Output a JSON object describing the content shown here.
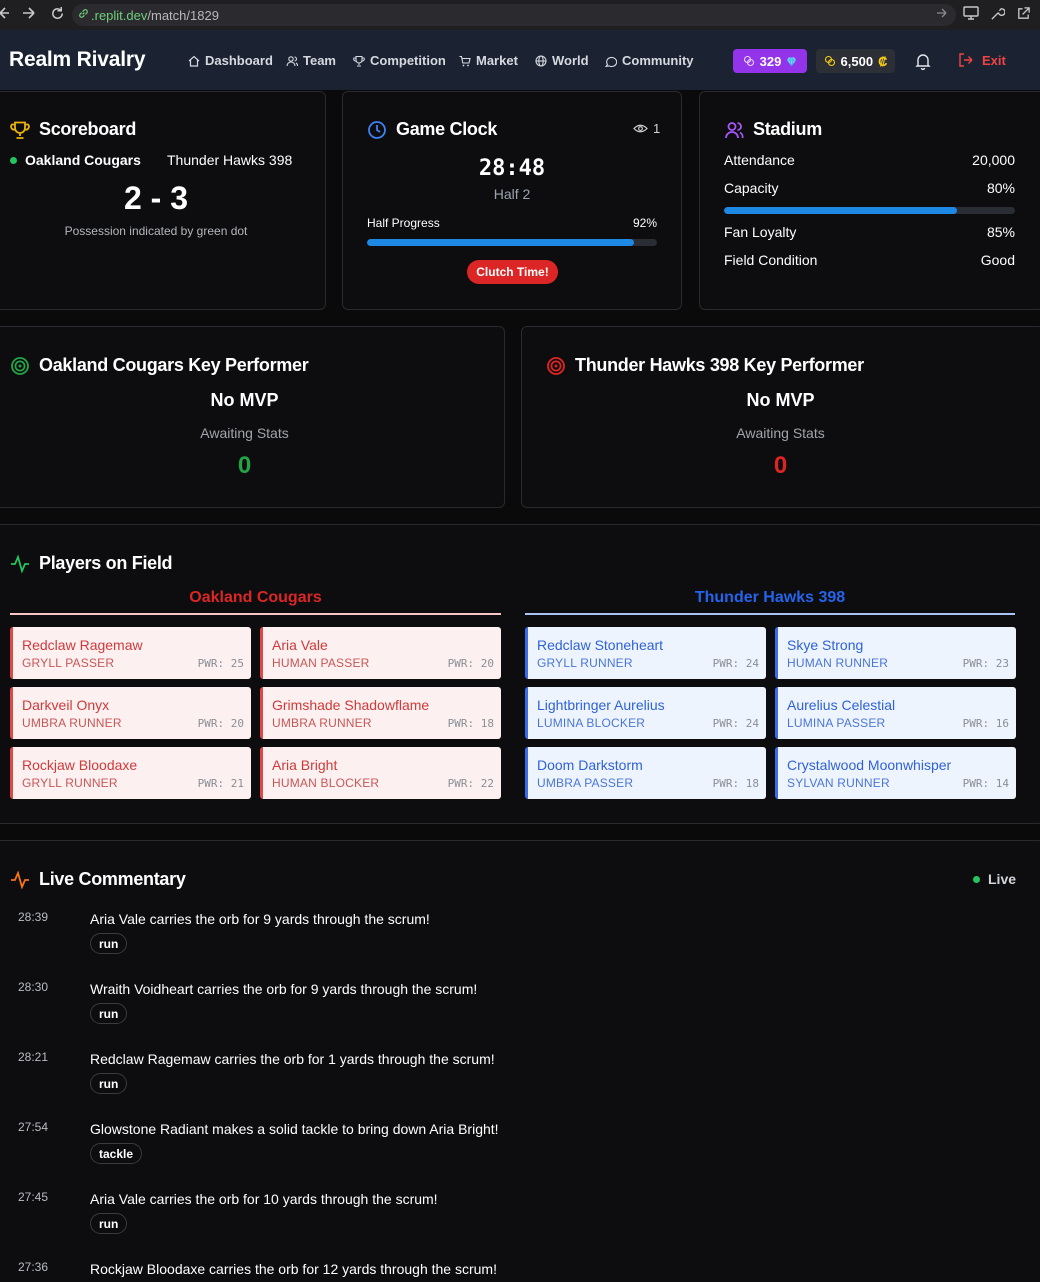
{
  "browser": {
    "url_domain": ".replit.dev",
    "url_path": "/match/1829"
  },
  "header": {
    "brand": "Realm Rivalry",
    "nav": [
      {
        "label": "Dashboard",
        "icon": "home-icon"
      },
      {
        "label": "Team",
        "icon": "users-icon"
      },
      {
        "label": "Competition",
        "icon": "trophy-icon"
      },
      {
        "label": "Market",
        "icon": "cart-icon"
      },
      {
        "label": "World",
        "icon": "globe-icon"
      },
      {
        "label": "Community",
        "icon": "chat-icon"
      }
    ],
    "gems": "329",
    "coins": "6,500",
    "coin_symbol": "₡",
    "exit_label": "Exit"
  },
  "scoreboard": {
    "title": "Scoreboard",
    "team_home": "Oakland Cougars",
    "team_away": "Thunder Hawks 398",
    "score": "2 - 3",
    "note": "Possession indicated by green dot"
  },
  "clock": {
    "title": "Game Clock",
    "viewers": "1",
    "time": "28:48",
    "half": "Half 2",
    "progress_label": "Half Progress",
    "progress_text": "92%",
    "progress_value": 0.92,
    "clutch_label": "Clutch Time!"
  },
  "stadium": {
    "title": "Stadium",
    "attendance_label": "Attendance",
    "attendance": "20,000",
    "capacity_label": "Capacity",
    "capacity": "80%",
    "capacity_value": 0.8,
    "loyalty_label": "Fan Loyalty",
    "loyalty": "85%",
    "field_label": "Field Condition",
    "field": "Good"
  },
  "performers": {
    "home": {
      "title": "Oakland Cougars Key Performer",
      "mvp": "No MVP",
      "status": "Awaiting Stats",
      "value": "0",
      "color": "#22a447"
    },
    "away": {
      "title": "Thunder Hawks 398 Key Performer",
      "mvp": "No MVP",
      "status": "Awaiting Stats",
      "value": "0",
      "color": "#e02424"
    }
  },
  "field": {
    "title": "Players on Field",
    "home_name": "Oakland Cougars",
    "away_name": "Thunder Hawks 398",
    "home_players": [
      {
        "name": "Redclaw Ragemaw",
        "role": "GRYLL PASSER",
        "pwr": "PWR: 25"
      },
      {
        "name": "Aria Vale",
        "role": "HUMAN PASSER",
        "pwr": "PWR: 20"
      },
      {
        "name": "Darkveil Onyx",
        "role": "UMBRA RUNNER",
        "pwr": "PWR: 20"
      },
      {
        "name": "Grimshade Shadowflame",
        "role": "UMBRA RUNNER",
        "pwr": "PWR: 18"
      },
      {
        "name": "Rockjaw Bloodaxe",
        "role": "GRYLL RUNNER",
        "pwr": "PWR: 21"
      },
      {
        "name": "Aria Bright",
        "role": "HUMAN BLOCKER",
        "pwr": "PWR: 22"
      }
    ],
    "away_players": [
      {
        "name": "Redclaw Stoneheart",
        "role": "GRYLL RUNNER",
        "pwr": "PWR: 24"
      },
      {
        "name": "Skye Strong",
        "role": "HUMAN RUNNER",
        "pwr": "PWR: 23"
      },
      {
        "name": "Lightbringer Aurelius",
        "role": "LUMINA BLOCKER",
        "pwr": "PWR: 24"
      },
      {
        "name": "Aurelius Celestial",
        "role": "LUMINA PASSER",
        "pwr": "PWR: 16"
      },
      {
        "name": "Doom Darkstorm",
        "role": "UMBRA PASSER",
        "pwr": "PWR: 18"
      },
      {
        "name": "Crystalwood Moonwhisper",
        "role": "SYLVAN RUNNER",
        "pwr": "PWR: 14"
      }
    ]
  },
  "commentary": {
    "title": "Live Commentary",
    "live_label": "Live",
    "events": [
      {
        "time": "28:39",
        "text": "Aria Vale carries the orb for 9 yards through the scrum!",
        "tag": "run"
      },
      {
        "time": "28:30",
        "text": "Wraith Voidheart carries the orb for 9 yards through the scrum!",
        "tag": "run"
      },
      {
        "time": "28:21",
        "text": "Redclaw Ragemaw carries the orb for 1 yards through the scrum!",
        "tag": "run"
      },
      {
        "time": "27:54",
        "text": "Glowstone Radiant makes a solid tackle to bring down Aria Bright!",
        "tag": "tackle"
      },
      {
        "time": "27:45",
        "text": "Aria Vale carries the orb for 10 yards through the scrum!",
        "tag": "run"
      },
      {
        "time": "27:36",
        "text": "Rockjaw Bloodaxe carries the orb for 12 yards through the scrum!",
        "tag": ""
      }
    ]
  }
}
